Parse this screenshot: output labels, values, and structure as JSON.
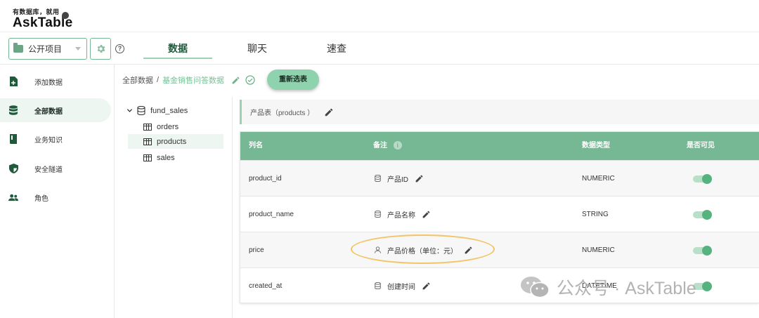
{
  "logo": {
    "slogan": "有数据库，就用",
    "name": "AskTable"
  },
  "nav": {
    "project": "公开项目",
    "tabs": [
      {
        "label": "数据",
        "active": true
      },
      {
        "label": "聊天",
        "active": false
      },
      {
        "label": "速查",
        "active": false
      }
    ]
  },
  "sidebar": {
    "items": [
      {
        "label": "添加数据",
        "icon": "add-document-icon",
        "active": false
      },
      {
        "label": "全部数据",
        "icon": "database-icon",
        "active": true
      },
      {
        "label": "业务知识",
        "icon": "book-icon",
        "active": false
      },
      {
        "label": "安全隧道",
        "icon": "shield-icon",
        "active": false
      },
      {
        "label": "角色",
        "icon": "people-icon",
        "active": false
      }
    ]
  },
  "breadcrumb": {
    "root": "全部数据",
    "separator": "/",
    "current": "基金销售问答数据"
  },
  "reselect_button": "重新选表",
  "tree": {
    "database": "fund_sales",
    "tables": [
      {
        "name": "orders",
        "selected": false
      },
      {
        "name": "products",
        "selected": true
      },
      {
        "name": "sales",
        "selected": false
      }
    ]
  },
  "table_panel": {
    "title": "产品表（products ）",
    "headers": {
      "column_name": "列名",
      "note": "备注",
      "data_type": "数据类型",
      "visible": "是否可见"
    },
    "rows": [
      {
        "name": "product_id",
        "note": "产品ID",
        "note_icon": "database-icon",
        "type": "NUMERIC",
        "visible": true
      },
      {
        "name": "product_name",
        "note": "产品名称",
        "note_icon": "database-icon",
        "type": "STRING",
        "visible": true
      },
      {
        "name": "price",
        "note": "产品价格（单位：元）",
        "note_icon": "user-icon",
        "type": "NUMERIC",
        "visible": true
      },
      {
        "name": "created_at",
        "note": "创建时间",
        "note_icon": "database-icon",
        "type": "DATETIME",
        "visible": true
      }
    ]
  },
  "watermark": {
    "text": "公众号 · AskTable"
  },
  "colors": {
    "accent": "#76b893",
    "accent_light": "#8fd2ae",
    "highlight": "#f3c466"
  }
}
